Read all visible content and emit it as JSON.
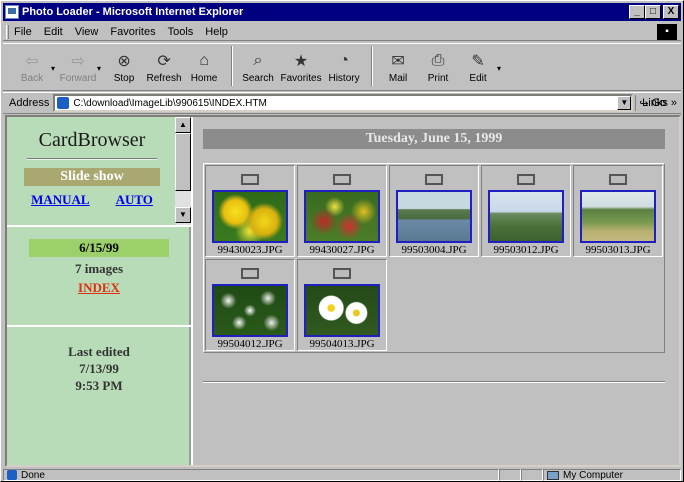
{
  "window": {
    "title": "Photo Loader - Microsoft Internet Explorer",
    "buttons": [
      "_",
      "□",
      "X"
    ]
  },
  "menu": [
    "File",
    "Edit",
    "View",
    "Favorites",
    "Tools",
    "Help"
  ],
  "toolbar": [
    {
      "label": "Back",
      "icon": "back-arrow-icon",
      "enabled": false
    },
    {
      "label": "Forward",
      "icon": "forward-arrow-icon",
      "enabled": false
    },
    {
      "label": "Stop",
      "icon": "stop-icon",
      "enabled": true
    },
    {
      "label": "Refresh",
      "icon": "refresh-icon",
      "enabled": true
    },
    {
      "label": "Home",
      "icon": "home-icon",
      "enabled": true
    },
    {
      "label": "Search",
      "icon": "search-icon",
      "enabled": true
    },
    {
      "label": "Favorites",
      "icon": "favorites-icon",
      "enabled": true
    },
    {
      "label": "History",
      "icon": "history-icon",
      "enabled": true
    },
    {
      "label": "Mail",
      "icon": "mail-icon",
      "enabled": true
    },
    {
      "label": "Print",
      "icon": "print-icon",
      "enabled": true
    },
    {
      "label": "Edit",
      "icon": "edit-icon",
      "enabled": true
    }
  ],
  "address": {
    "label": "Address",
    "value": "C:\\download\\ImageLib\\990615\\INDEX.HTM",
    "go": "Go",
    "links": "Links »"
  },
  "sidebar": {
    "title": "CardBrowser",
    "slideshow": "Slide show",
    "modes": [
      "MANUAL",
      "AUTO"
    ],
    "date": "6/15/99",
    "count": "7 images",
    "index_link": "INDEX",
    "edited_label": "Last edited",
    "edited_date": "7/13/99",
    "edited_time": "9:53 PM"
  },
  "main": {
    "heading": "Tuesday, June 15, 1999",
    "images": [
      {
        "name": "99430023.JPG"
      },
      {
        "name": "99430027.JPG"
      },
      {
        "name": "99503004.JPG"
      },
      {
        "name": "99503012.JPG"
      },
      {
        "name": "99503013.JPG"
      },
      {
        "name": "99504012.JPG"
      },
      {
        "name": "99504013.JPG"
      }
    ]
  },
  "status": {
    "text": "Done",
    "zone": "My Computer"
  },
  "colors": {
    "titlebar": "#000080",
    "sidebar_bg": "#b8dcb8",
    "heading_bar": "#8c8c8c",
    "link": "#0000ee",
    "index_link": "#e03010"
  }
}
